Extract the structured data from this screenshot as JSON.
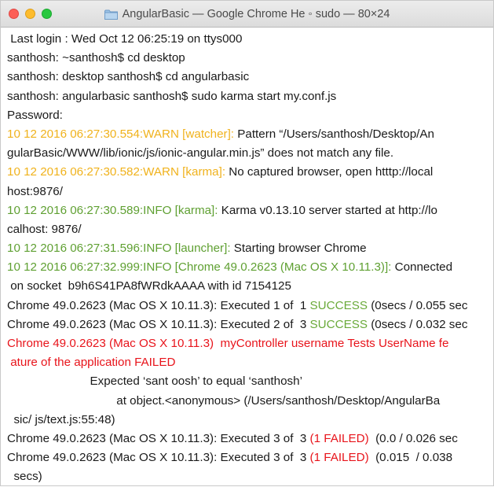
{
  "window": {
    "title": "AngularBasic — Google Chrome He ◦ sudo — 80×24",
    "icon": "folder-icon"
  },
  "colors": {
    "warn": "#f0b21c",
    "info": "#5fa032",
    "success": "#6aaa3a",
    "error": "#e8141b"
  },
  "terminal": {
    "lines": [
      [
        {
          "t": " Last login : Wed Oct 12 06:25:19 on ttys000"
        }
      ],
      [
        {
          "t": "santhosh: ~santhosh$ cd desktop"
        }
      ],
      [
        {
          "t": "santhosh: desktop santhosh$ cd angularbasic"
        }
      ],
      [
        {
          "t": "santhosh: angularbasic santhosh$ sudo karma start my.conf.js"
        }
      ],
      [
        {
          "t": "Password:"
        }
      ],
      [
        {
          "t": "10 12 2016 06:27:30.554:WARN [watcher]:",
          "c": "warn"
        },
        {
          "t": " Pattern “/Users/santhosh/Desktop/An"
        }
      ],
      [
        {
          "t": "gularBasic/WWW/lib/ionic/js/ionic-angular.min.js” does not match any file."
        }
      ],
      [
        {
          "t": "10 12 2016 06:27:30.582:WARN [karma]:",
          "c": "warn"
        },
        {
          "t": " No captured browser, open htttp://local"
        }
      ],
      [
        {
          "t": "host:9876/"
        }
      ],
      [
        {
          "t": "10 12 2016 06:27:30.589:INFO [karma]:",
          "c": "info"
        },
        {
          "t": " Karma v0.13.10 server started at http://lo"
        }
      ],
      [
        {
          "t": "calhost: 9876/"
        }
      ],
      [
        {
          "t": "10 12 2016 06:27:31.596:INFO [launcher]:",
          "c": "info"
        },
        {
          "t": " Starting browser Chrome"
        }
      ],
      [
        {
          "t": "10 12 2016 06:27:32.999:INFO [Chrome 49.0.2623 (Mac OS X 10.11.3)]:",
          "c": "info"
        },
        {
          "t": " Connected"
        }
      ],
      [
        {
          "t": " on socket  b9h6S41PA8fWRdkAAAA with id 7154125"
        }
      ],
      [
        {
          "t": "Chrome 49.0.2623 (Mac OS X 10.11.3): Executed 1 of  1 "
        },
        {
          "t": "SUCCESS",
          "c": "ok"
        },
        {
          "t": " (0secs / 0.055 sec"
        }
      ],
      [
        {
          "t": "Chrome 49.0.2623 (Mac OS X 10.11.3): Executed 2 of  3 "
        },
        {
          "t": "SUCCESS",
          "c": "ok"
        },
        {
          "t": " (0secs / 0.032 sec"
        }
      ],
      [
        {
          "t": "Chrome 49.0.2623 (Mac OS X 10.11.3)  myController username Tests UserName fe",
          "c": "err"
        }
      ],
      [
        {
          "t": " ature of the application FAILED",
          "c": "err"
        }
      ],
      [
        {
          "t": "                         Expected ‘sant oosh’ to equal ‘santhosh’"
        }
      ],
      [
        {
          "t": "                                 at object.<anonymous> (/Users/santhosh/Desktop/AngularBa"
        }
      ],
      [
        {
          "t": "  sic/ js/text.js:55:48)"
        }
      ],
      [
        {
          "t": "Chrome 49.0.2623 (Mac OS X 10.11.3): Executed 3 of  3 "
        },
        {
          "t": "(1 FAILED)",
          "c": "err"
        },
        {
          "t": "  (0.0 / 0.026 sec"
        }
      ],
      [
        {
          "t": "Chrome 49.0.2623 (Mac OS X 10.11.3): Executed 3 of  3 "
        },
        {
          "t": "(1 FAILED)",
          "c": "err"
        },
        {
          "t": "  (0.015  / 0.038"
        }
      ],
      [
        {
          "t": "  secs)"
        }
      ]
    ]
  }
}
